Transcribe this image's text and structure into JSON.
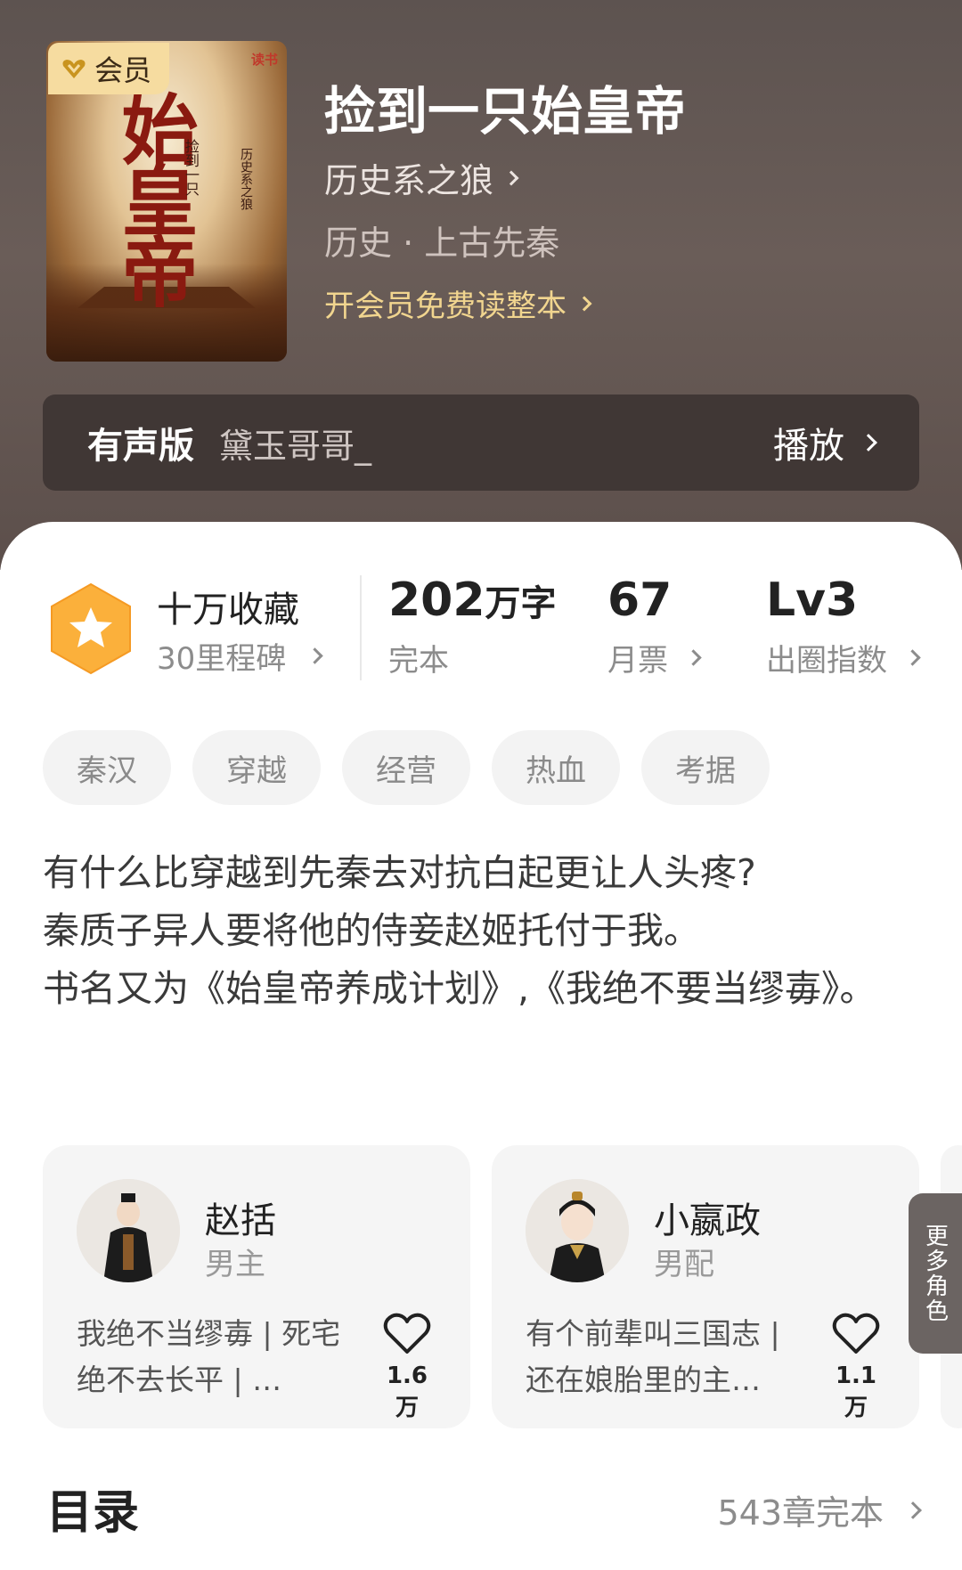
{
  "book": {
    "title": "捡到一只始皇帝",
    "author": "历史系之狼",
    "genre": "历史 · 上古先秦",
    "vip_badge": "会员",
    "vip_read": "开会员免费读整本"
  },
  "cover": {
    "big_text": "始皇帝",
    "small_text_1": "捡到一只",
    "small_text_2": "历史系之狼",
    "brand": "读书"
  },
  "audio": {
    "label": "有声版",
    "narrator": "黛玉哥哥_",
    "play": "播放"
  },
  "stats": {
    "fav_title": "十万收藏",
    "fav_sub": "30里程碑",
    "words_num": "202",
    "words_unit": "万字",
    "words_status": "完本",
    "tickets_num": "67",
    "tickets_label": "月票",
    "level": "Lv3",
    "level_label": "出圈指数"
  },
  "tags": [
    "秦汉",
    "穿越",
    "经营",
    "热血",
    "考据"
  ],
  "description": {
    "line1": "有什么比穿越到先秦去对抗白起更让人头疼?",
    "line2": "秦质子异人要将他的侍妾赵姬托付于我。",
    "line3": "书名又为《始皇帝养成计划》,《我绝不要当缪毐》。"
  },
  "characters": [
    {
      "name": "赵括",
      "role": "男主",
      "desc": "我绝不当缪毐 | 死宅绝不去长平 | …",
      "likes": "1.6万"
    },
    {
      "name": "小嬴政",
      "role": "男配",
      "desc": "有个前辈叫三国志 | 还在娘胎里的主…",
      "likes": "1.1万"
    }
  ],
  "more_roles": "更多角色",
  "toc": {
    "title": "目录",
    "chapters": "543章完本"
  },
  "colors": {
    "hero_bg": "#5d5350",
    "vip_gold": "#f1d58f",
    "badge_orange": "#fbb03b"
  }
}
